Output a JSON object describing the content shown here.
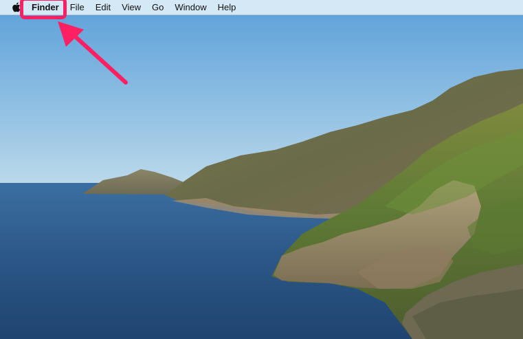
{
  "menubar": {
    "apple_icon": "apple-logo",
    "app_name": "Finder",
    "items": [
      "File",
      "Edit",
      "View",
      "Go",
      "Window",
      "Help"
    ]
  },
  "annotation": {
    "color": "#ff1f63",
    "target": "Finder"
  },
  "colors": {
    "sky_top": "#5ea3dc",
    "sky_bottom": "#b8d7ea",
    "sea": "#2f5b8c"
  }
}
